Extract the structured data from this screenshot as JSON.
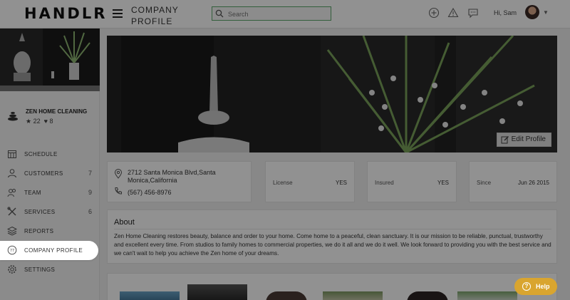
{
  "header": {
    "logo": "HANDLR",
    "title": "COMPANY PROFILE",
    "search_placeholder": "Search",
    "greeting": "Hi, Sam"
  },
  "business": {
    "name": "ZEN HOME CLEANING",
    "rating": "22",
    "likes": "8"
  },
  "nav": {
    "items": [
      {
        "label": "SCHEDULE",
        "count": "",
        "icon": "calendar-icon"
      },
      {
        "label": "CUSTOMERS",
        "count": "7",
        "icon": "user-icon"
      },
      {
        "label": "TEAM",
        "count": "9",
        "icon": "team-icon"
      },
      {
        "label": "SERVICES",
        "count": "6",
        "icon": "tools-icon"
      },
      {
        "label": "REPORTS",
        "count": "",
        "icon": "layers-icon"
      },
      {
        "label": "COMPANY PROFILE",
        "count": "",
        "icon": "company-icon"
      },
      {
        "label": "SETTINGS",
        "count": "",
        "icon": "gear-icon"
      }
    ],
    "active": "COMPANY PROFILE"
  },
  "hero": {
    "edit_label": "Edit Profile"
  },
  "contact": {
    "address": "2712 Santa Monica Blvd,Santa Monica,California",
    "phone": "(567) 456-8976"
  },
  "info": {
    "license_label": "License",
    "license_value": "YES",
    "insured_label": "Insured",
    "insured_value": "YES",
    "since_label": "Since",
    "since_value": "Jun 26 2015"
  },
  "about": {
    "heading": "About",
    "text": "Zen Home Cleaning restores beauty, balance and order to your home. Come home to a peaceful, clean sanctuary. It is our mission to be reliable, punctual, trustworthy and excellent every time. From studios to family homes to commercial properties, we do it all and we do it well. We look forward to providing you with the best service and we can't wait to help you achieve the Zen home of your dreams."
  },
  "help": {
    "label": "Help"
  },
  "colors": {
    "accent_green": "#5aa86a",
    "help_gold": "#d9a52f"
  }
}
